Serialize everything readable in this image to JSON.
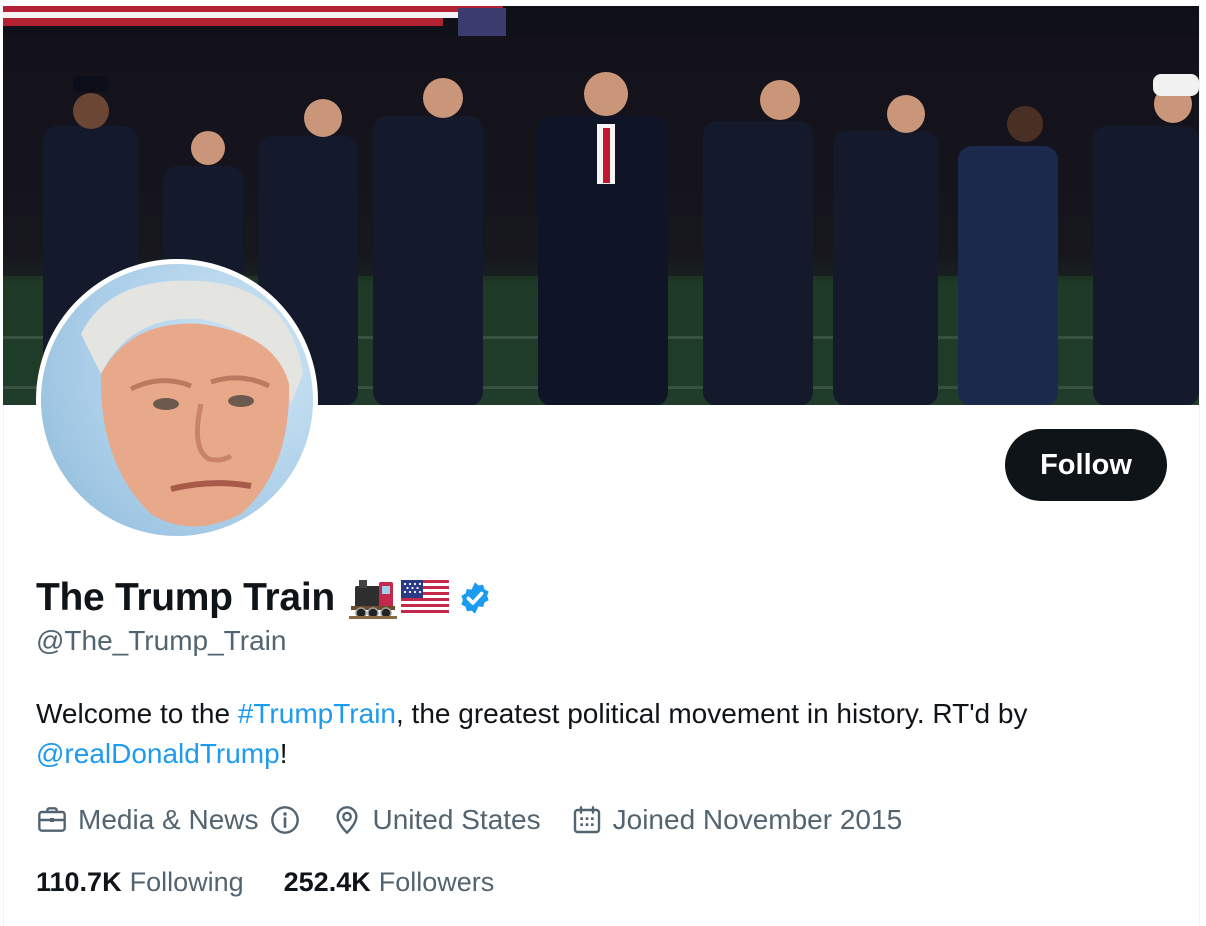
{
  "profile": {
    "display_name": "The Trump Train",
    "name_emoji": [
      "train-emoji",
      "us-flag-emoji"
    ],
    "verified": true,
    "handle": "@The_Trump_Train",
    "follow_label": "Follow"
  },
  "bio": {
    "part1": "Welcome to the ",
    "hashtag": "#TrumpTrain",
    "part2": ", the greatest political movement in history. RT'd by",
    "mention": "@realDonaldTrump",
    "part3": "!"
  },
  "meta": {
    "category": "Media & News",
    "location": "United States",
    "joined": "Joined November 2015"
  },
  "stats": {
    "following_count": "110.7K",
    "following_label": "Following",
    "followers_count": "252.4K",
    "followers_label": "Followers"
  },
  "colors": {
    "link": "#1d9bf0",
    "verified": "#1d9bf0",
    "text_primary": "#0f1419",
    "text_secondary": "#536471",
    "follow_bg": "#0f1419"
  }
}
